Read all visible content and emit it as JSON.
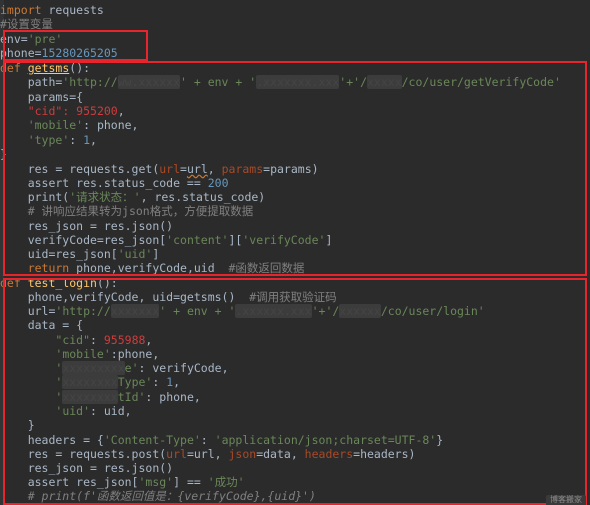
{
  "editor": {
    "lines": {
      "l1_kw": "import",
      "l1_rest": " requests",
      "l2": "#设置变量",
      "l3_a": "env=",
      "l3_b": "'pre'",
      "l4_a": "phone=",
      "l4_b": "15280265205",
      "l5_kw": "def",
      "l5_fn": "getsms",
      "l5_rest": "():",
      "l6_a": "    path=",
      "l6_b": "'http://",
      "l6_mask1": "ww.xxxxxx",
      "l6_c": "' + env + '",
      "l6_mask2": ".xxxxxxx.xxx",
      "l6_d": "'+'",
      "l6_e": "/",
      "l6_mask3": "xxxxx",
      "l6_f": "/co/user/getVerifyCode'",
      "l7": "    params={",
      "l8_a": "    ",
      "l8_b": "\"cid\": 955200",
      "l8_c": ",",
      "l9_a": "    ",
      "l9_b": "'mobile'",
      "l9_c": ": phone,",
      "l10_a": "    ",
      "l10_b": "'type'",
      "l10_c": ": ",
      "l10_d": "1",
      "l10_e": ",",
      "l11": "}",
      "l13_a": "    res_json = res.json() ",
      "l13_pre": "    res = requests.get(",
      "l13_k1": "url",
      "l13_m1": "=",
      "l13_u": "url",
      "l13_m2": ", ",
      "l13_k2": "params",
      "l13_m3": "=params)",
      "l14_a": "    assert res.status_code == ",
      "l14_b": "200",
      "l15_a": "    print(",
      "l15_b": "'请求状态：'",
      "l15_c": ", res.status_code)",
      "l16": "    # 讲响应结果转为json格式，方便提取数据",
      "l17": "    res_json = res.json()",
      "l18_a": "    verifyCode=res_json[",
      "l18_b": "'content'",
      "l18_c": "][",
      "l18_d": "'verifyCode'",
      "l18_e": "]",
      "l19_a": "    uid=res_json[",
      "l19_b": "'uid'",
      "l19_c": "]",
      "l20_kw": "    return",
      "l20_b": " phone,verifyCode,uid  ",
      "l20_c": "#函数返回数据",
      "l21_kw": "def",
      "l21_fn": " test_login",
      "l21_rest": "():",
      "l22_a": "    phone,verifyCode, uid=getsms()  ",
      "l22_b": "#调用获取验证码",
      "l23_a": "    url=",
      "l23_b": "'http://",
      "l23_mask1": "xxxxxxx",
      "l23_c": "' + env + '",
      "l23_mask2": ".xxxxxx.xxx",
      "l23_d": "'+'/",
      "l23_mask3": "xxxxxx",
      "l23_e": "/co/user/login'",
      "l24": "    data = {",
      "l25_a": "        ",
      "l25_b": "\"cid\"",
      "l25_c": ": ",
      "l25_d": "955988",
      "l25_e": ",",
      "l26_a": "        ",
      "l26_b": "'mobile'",
      "l26_c": ":phone,",
      "l27_a": "        ",
      "l27_b": "'",
      "l27_mask": "xxxxxxxxx",
      "l27_c": "e'",
      "l27_d": ": verifyCode,",
      "l28_a": "        ",
      "l28_b": "'",
      "l28_mask": "xxxxxxxx",
      "l28_c": "Type'",
      "l28_d": ": ",
      "l28_e": "1",
      "l28_f": ",",
      "l29_a": "        ",
      "l29_b": "'",
      "l29_mask": "xxxxxxxx",
      "l29_c": "tId'",
      "l29_d": ": phone,",
      "l30_a": "        ",
      "l30_b": "'uid'",
      "l30_c": ": uid,",
      "l31": "    }",
      "l32_a": "    headers = {",
      "l32_b": "'Content-Type'",
      "l32_c": ": ",
      "l32_d": "'application/json;charset=UTF-8'",
      "l32_e": "}",
      "l33_a": "    res = requests.post(",
      "l33_k1": "url",
      "l33_b": "=url, ",
      "l33_k2": "json",
      "l33_c": "=data, ",
      "l33_k3": "headers",
      "l33_d": "=headers)",
      "l34": "    res_json = res.json()",
      "l35_a": "    assert res_json[",
      "l35_b": "'msg'",
      "l35_c": "] == ",
      "l35_d": "'成功'",
      "l36": "    # print(f'函数返回值是：{verifyCode},{uid}')"
    },
    "badge": "博客搬家"
  },
  "colors": {
    "background": "#2b2b2b",
    "keyword": "#cc7832",
    "string": "#6a8759",
    "number": "#6897bb",
    "comment": "#808080",
    "highlight_box": "#e8242c"
  }
}
